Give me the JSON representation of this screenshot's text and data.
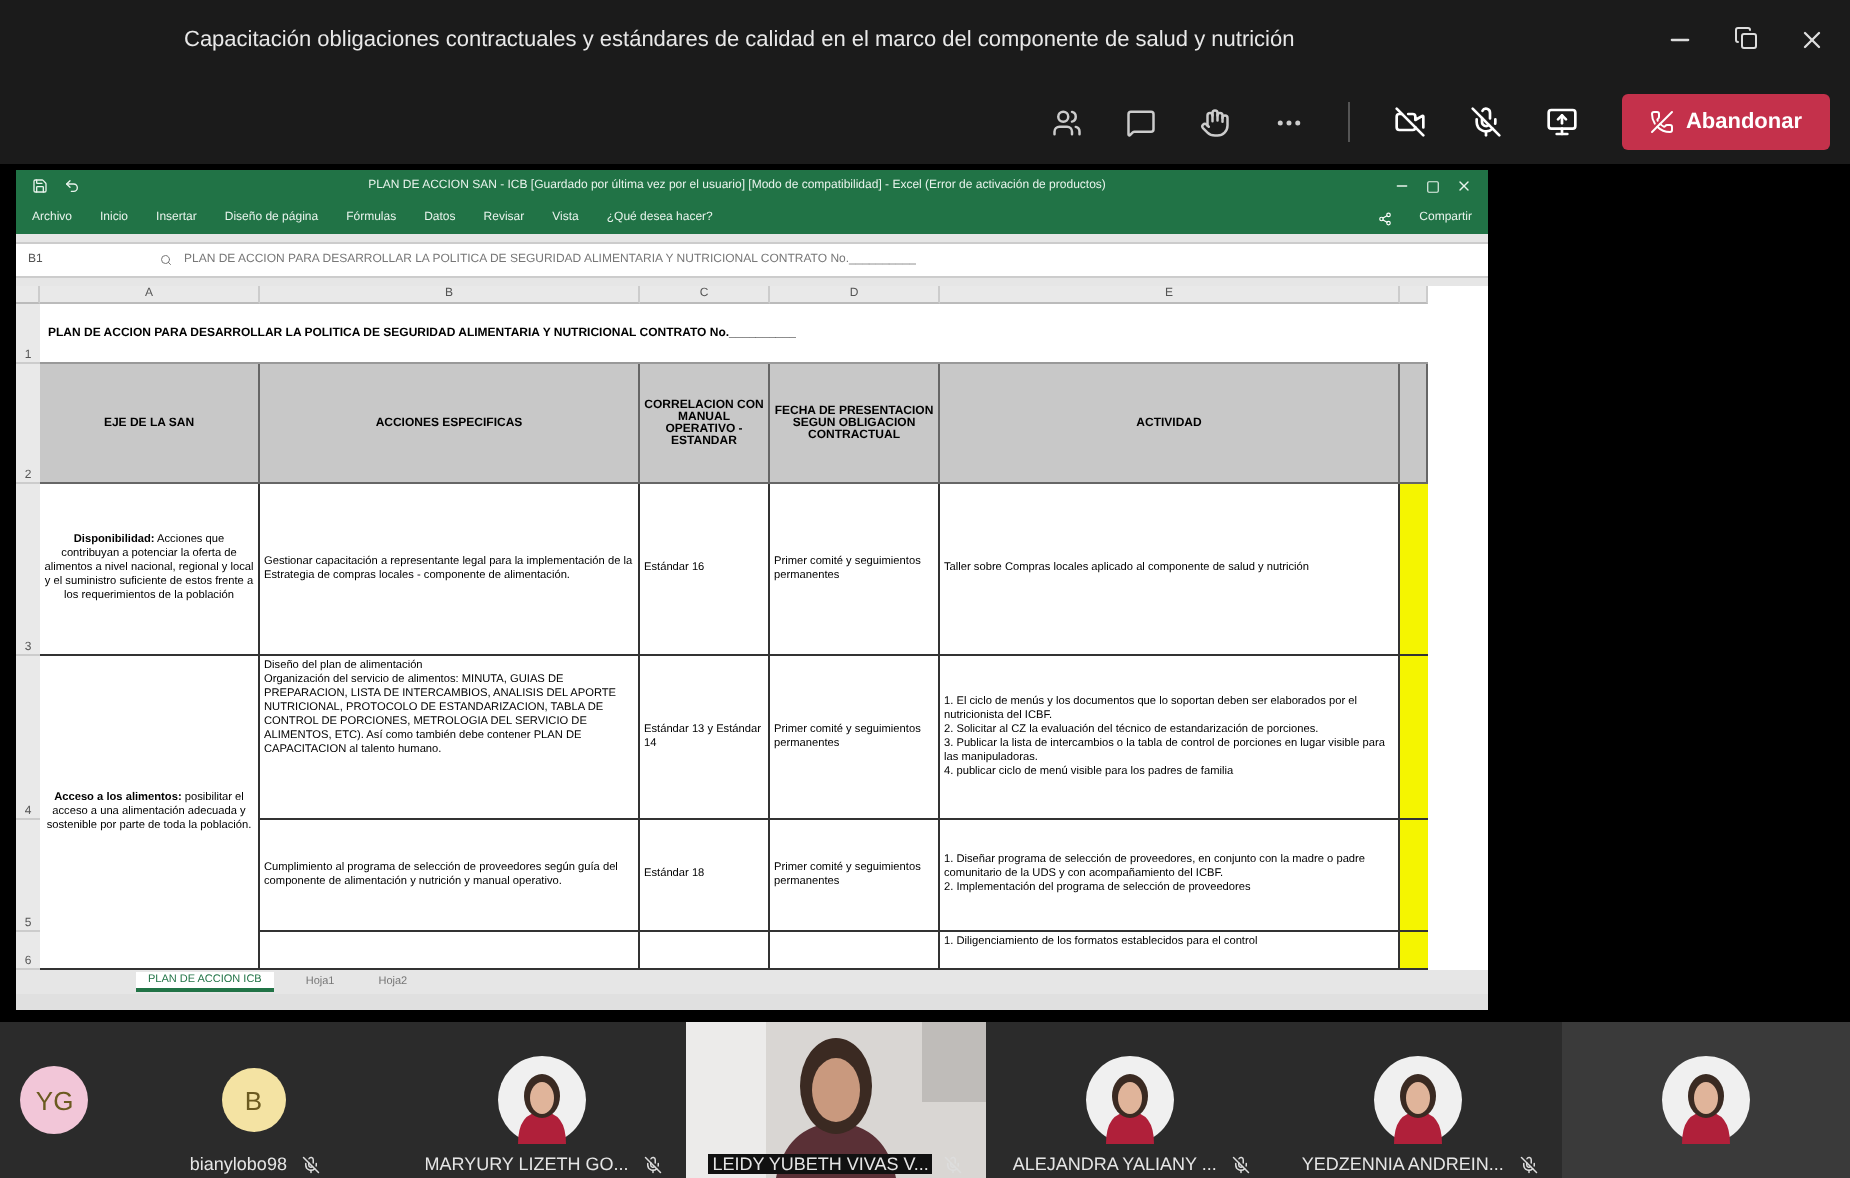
{
  "meeting": {
    "title": "Capacitación obligaciones contractuales y estándares de calidad en el marco del componente de salud y nutrición",
    "leave_button": "Abandonar"
  },
  "excel": {
    "file_title": "PLAN DE ACCION SAN - ICB [Guardado por última vez por el usuario] [Modo de compatibilidad] - Excel (Error de activación de productos)",
    "ribbon_tabs": [
      "Archivo",
      "Inicio",
      "Insertar",
      "Diseño de página",
      "Fórmulas",
      "Datos",
      "Revisar",
      "Vista",
      "¿Qué desea hacer?"
    ],
    "share": "Compartir",
    "name_box": "B1",
    "formula": "PLAN DE ACCION PARA DESARROLLAR LA POLITICA DE SEGURIDAD ALIMENTARIA Y NUTRICIONAL CONTRATO No.__________",
    "column_letters": [
      "A",
      "B",
      "C",
      "D",
      "E"
    ],
    "sheet_title": "PLAN DE ACCION PARA DESARROLLAR LA POLITICA DE SEGURIDAD ALIMENTARIA Y NUTRICIONAL CONTRATO No.__________",
    "title_row": "1",
    "header_row": "2",
    "headers": [
      "EJE DE LA SAN",
      "ACCIONES ESPECIFICAS",
      "CORRELACION CON MANUAL OPERATIVO - ESTANDAR",
      "FECHA DE PRESENTACION SEGUN OBLIGACION CONTRACTUAL",
      "ACTIVIDAD"
    ],
    "rows": [
      {
        "number": "3",
        "axis": "**Disponibilidad:** Acciones que contribuyan a potenciar la oferta de alimentos a nivel nacional, regional y local y el suministro suficiente de estos frente a los requerimientos de la población",
        "action": "Gestionar capacitación a representante legal para la implementación de la Estrategia de compras locales - componente de alimentación.",
        "standard": "Estándar 16",
        "date": "Primer comité y seguimientos permanentes",
        "activity": "Taller sobre Compras locales aplicado al componente de salud y nutrición"
      },
      {
        "number": "4",
        "axis": "**Acceso a los alimentos:** posibilitar el acceso a una alimentación adecuada y sostenible por parte de toda la población.",
        "action": "Diseño del plan de alimentación\nOrganización del servicio de alimentos: MINUTA, GUIAS DE PREPARACION, LISTA DE INTERCAMBIOS, ANALISIS DEL APORTE NUTRICIONAL, PROTOCOLO DE ESTANDARIZACION, TABLA DE CONTROL DE PORCIONES, METROLOGIA DEL SERVICIO DE ALIMENTOS, ETC). Así como también debe contener PLAN DE CAPACITACION al talento humano.",
        "standard": "Estándar 13 y Estándar 14",
        "date": "Primer comité y seguimientos permanentes",
        "activity": "1. El ciclo de menús y los documentos que lo soportan deben ser elaborados por el nutricionista del ICBF.\n2. Solicitar al CZ la evaluación del técnico de estandarización de porciones.\n3. Publicar la lista de intercambios o la tabla de control de porciones en lugar visible para las manipuladoras.\n4. publicar ciclo de menú visible para los padres de familia"
      },
      {
        "number": "5",
        "action": "Cumplimiento al programa de selección de proveedores según guía del componente de alimentación y nutrición y manual operativo.",
        "standard": "Estándar 18",
        "date": "Primer comité y seguimientos permanentes",
        "activity": "1. Diseñar programa de selección de proveedores, en conjunto con la madre o padre comunitario de la UDS y con acompañamiento del ICBF.\n2. Implementación del programa de selección de proveedores"
      },
      {
        "number": "6",
        "activity": "1. Diligenciamiento de los formatos establecidos para el control"
      }
    ],
    "sheet_tabs": [
      {
        "label": "PLAN DE ACCION ICB",
        "selected": true
      },
      {
        "label": "Hoja1",
        "selected": false
      },
      {
        "label": "Hoja2",
        "selected": false
      }
    ]
  },
  "participants": [
    {
      "kind": "initials",
      "initials": "YG",
      "color": "#f2c6d8"
    },
    {
      "kind": "initials",
      "initials": "B",
      "name": "bianylobo98",
      "color": "#f4e3a3"
    },
    {
      "kind": "avatar",
      "name": "MARYURY LIZETH GO..."
    },
    {
      "kind": "video",
      "name": "LEIDY YUBETH VIVAS V..."
    },
    {
      "kind": "avatar",
      "name": "ALEJANDRA YALIANY ..."
    },
    {
      "kind": "avatar",
      "name": "YEDZENNIA ANDREIN..."
    },
    {
      "kind": "avatar"
    }
  ]
}
